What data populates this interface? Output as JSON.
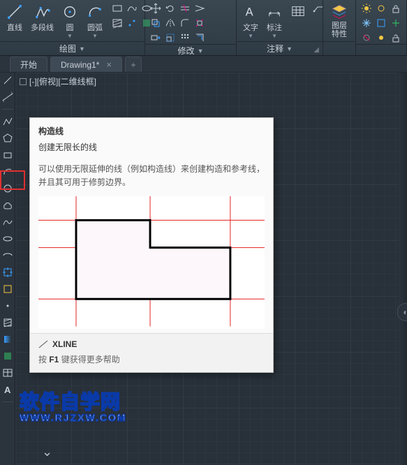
{
  "ribbon": {
    "panels": {
      "draw": {
        "title": "绘图",
        "items": {
          "line": "直线",
          "polyline": "多段线",
          "circle": "圆",
          "arc": "圆弧"
        }
      },
      "modify": {
        "title": "修改"
      },
      "annotation": {
        "title": "注释",
        "items": {
          "text": "文字",
          "dim": "标注",
          "table": ""
        }
      },
      "layer": {
        "title": "",
        "items": {
          "props": "图层\n特性"
        }
      }
    }
  },
  "tabs": {
    "start": "开始",
    "drawing": "Drawing1*"
  },
  "view_label": "[-][俯视][二维线框]",
  "tooltip": {
    "title": "构造线",
    "subtitle": "创建无限长的线",
    "desc": "可以使用无限延伸的线（例如构造线）来创建构造和参考线，并且其可用于修剪边界。",
    "command_icon": "xline-icon",
    "command": "XLINE",
    "help_prefix": "按 ",
    "help_key": "F1",
    "help_suffix": " 键获得更多帮助"
  },
  "watermark": {
    "line1": "软件自学网",
    "line2": "WWW.RJZXW.COM"
  },
  "icons": {
    "line": "line-icon",
    "polyline": "polyline-icon",
    "circle": "circle-icon",
    "arc": "arc-icon",
    "text": "text-icon",
    "dim": "dimension-icon",
    "table": "table-icon",
    "layer": "layer-stack-icon"
  }
}
